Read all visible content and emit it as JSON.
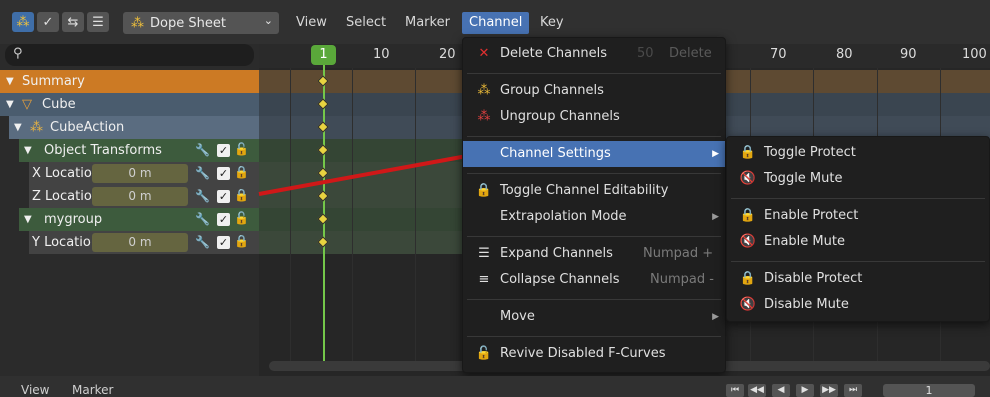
{
  "header": {
    "editor_mode": "Dope Sheet",
    "menus": [
      "View",
      "Select",
      "Marker",
      "Channel",
      "Key"
    ],
    "active_menu": "Channel"
  },
  "channels": {
    "summary": "Summary",
    "object": "Cube",
    "action": "CubeAction",
    "group1": "Object Transforms",
    "x_loc": {
      "label": "X Locatio",
      "value": "0 m"
    },
    "z_loc": {
      "label": "Z Locatio",
      "value": "0 m"
    },
    "group2": "mygroup",
    "y_loc": {
      "label": "Y Locatio",
      "value": "0 m"
    }
  },
  "timeline": {
    "current_frame": "1",
    "ticks": [
      "10",
      "20",
      "70",
      "80",
      "90",
      "100"
    ],
    "ghost_ticks": [
      "50",
      "Delete"
    ]
  },
  "channel_menu": {
    "delete": "Delete Channels",
    "group": "Group Channels",
    "ungroup": "Ungroup Channels",
    "settings": "Channel Settings",
    "toggle_edit": "Toggle Channel Editability",
    "extrapolation": "Extrapolation Mode",
    "expand": "Expand Channels",
    "expand_sc": "Numpad +",
    "collapse": "Collapse Channels",
    "collapse_sc": "Numpad -",
    "move": "Move",
    "revive": "Revive Disabled F-Curves"
  },
  "settings_menu": {
    "toggle_protect": "Toggle Protect",
    "toggle_mute": "Toggle Mute",
    "enable_protect": "Enable Protect",
    "enable_mute": "Enable Mute",
    "disable_protect": "Disable Protect",
    "disable_mute": "Disable Mute"
  },
  "bottom": {
    "view": "View",
    "marker": "Marker",
    "frame": "1"
  },
  "colors": {
    "accent": "#4772b3",
    "summary": "#d0731e",
    "playhead": "#74c74a",
    "keyframe": "#e8d340",
    "annotation_arrow": "#d01818"
  }
}
